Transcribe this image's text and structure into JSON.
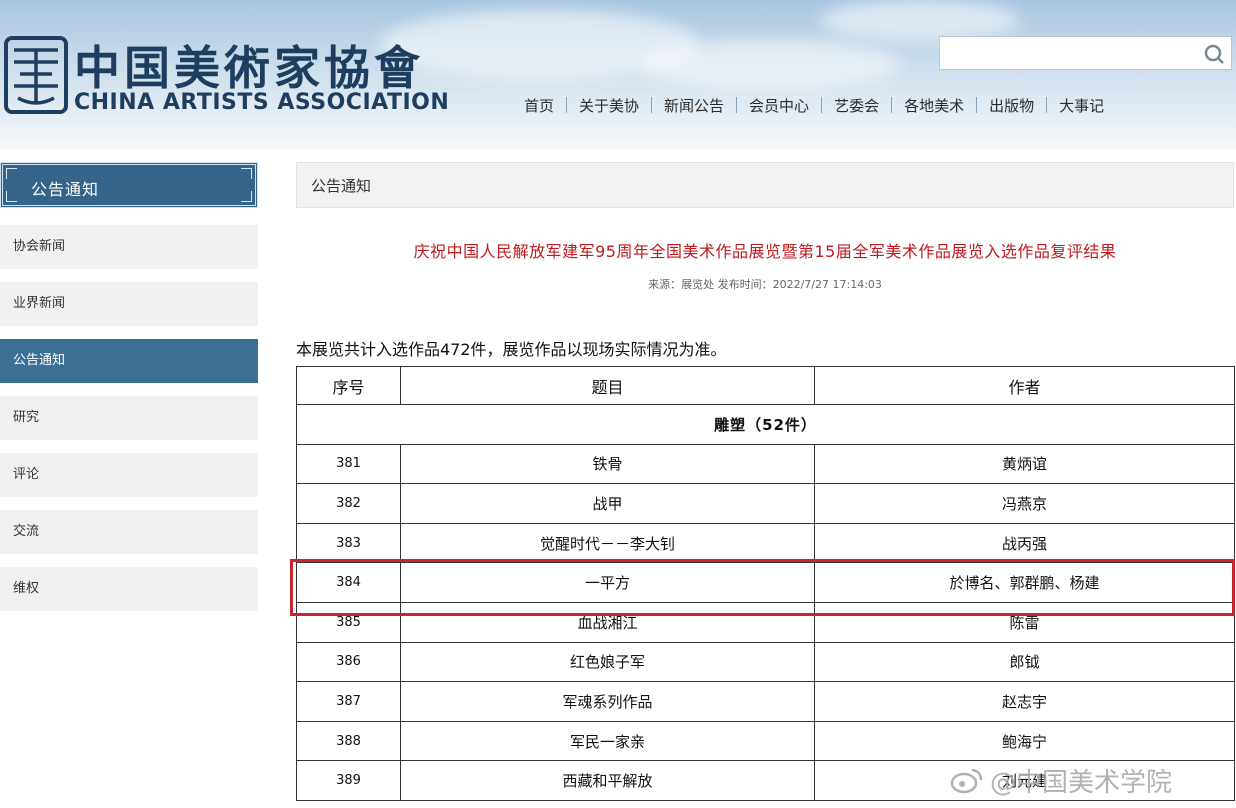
{
  "header": {
    "logo_cn": "中国美術家協會",
    "logo_en": "CHINA ARTISTS ASSOCIATION",
    "search": {
      "value": "",
      "placeholder": ""
    },
    "nav": [
      "首页",
      "关于美协",
      "新闻公告",
      "会员中心",
      "艺委会",
      "各地美术",
      "出版物",
      "大事记"
    ]
  },
  "sidebar": {
    "title": "公告通知",
    "items": [
      {
        "label": "协会新闻",
        "active": false
      },
      {
        "label": "业界新闻",
        "active": false
      },
      {
        "label": "公告通知",
        "active": true
      },
      {
        "label": "研究",
        "active": false
      },
      {
        "label": "评论",
        "active": false
      },
      {
        "label": "交流",
        "active": false
      },
      {
        "label": "维权",
        "active": false
      }
    ]
  },
  "main": {
    "section_title": "公告通知",
    "article_title": "庆祝中国人民解放军建军95周年全国美术作品展览暨第15届全军美术作品展览入选作品复评结果",
    "meta": "来源：展览处 发布时间：2022/7/27 17:14:03",
    "intro": "本展览共计入选作品472件，展览作品以现场实际情况为准。",
    "table": {
      "headers": [
        "序号",
        "题目",
        "作者"
      ],
      "category": "雕塑（52件）",
      "rows": [
        {
          "no": "381",
          "title": "铁骨",
          "author": "黄炳谊"
        },
        {
          "no": "382",
          "title": "战甲",
          "author": "冯燕京"
        },
        {
          "no": "383",
          "title": "觉醒时代－－李大钊",
          "author": "战丙强"
        },
        {
          "no": "384",
          "title": "一平方",
          "author": "於博名、郭群鹏、杨建"
        },
        {
          "no": "385",
          "title": "血战湘江",
          "author": "陈雷"
        },
        {
          "no": "386",
          "title": "红色娘子军",
          "author": "郎钺"
        },
        {
          "no": "387",
          "title": "军魂系列作品",
          "author": "赵志宇"
        },
        {
          "no": "388",
          "title": "军民一家亲",
          "author": "鲍海宁"
        },
        {
          "no": "389",
          "title": "西藏和平解放",
          "author": "刘元建"
        }
      ]
    }
  },
  "watermark": "@中国美术学院",
  "colors": {
    "title_red": "#c0191e",
    "sidebar_blue": "#3b6f95",
    "highlight_red": "#c6262c"
  }
}
